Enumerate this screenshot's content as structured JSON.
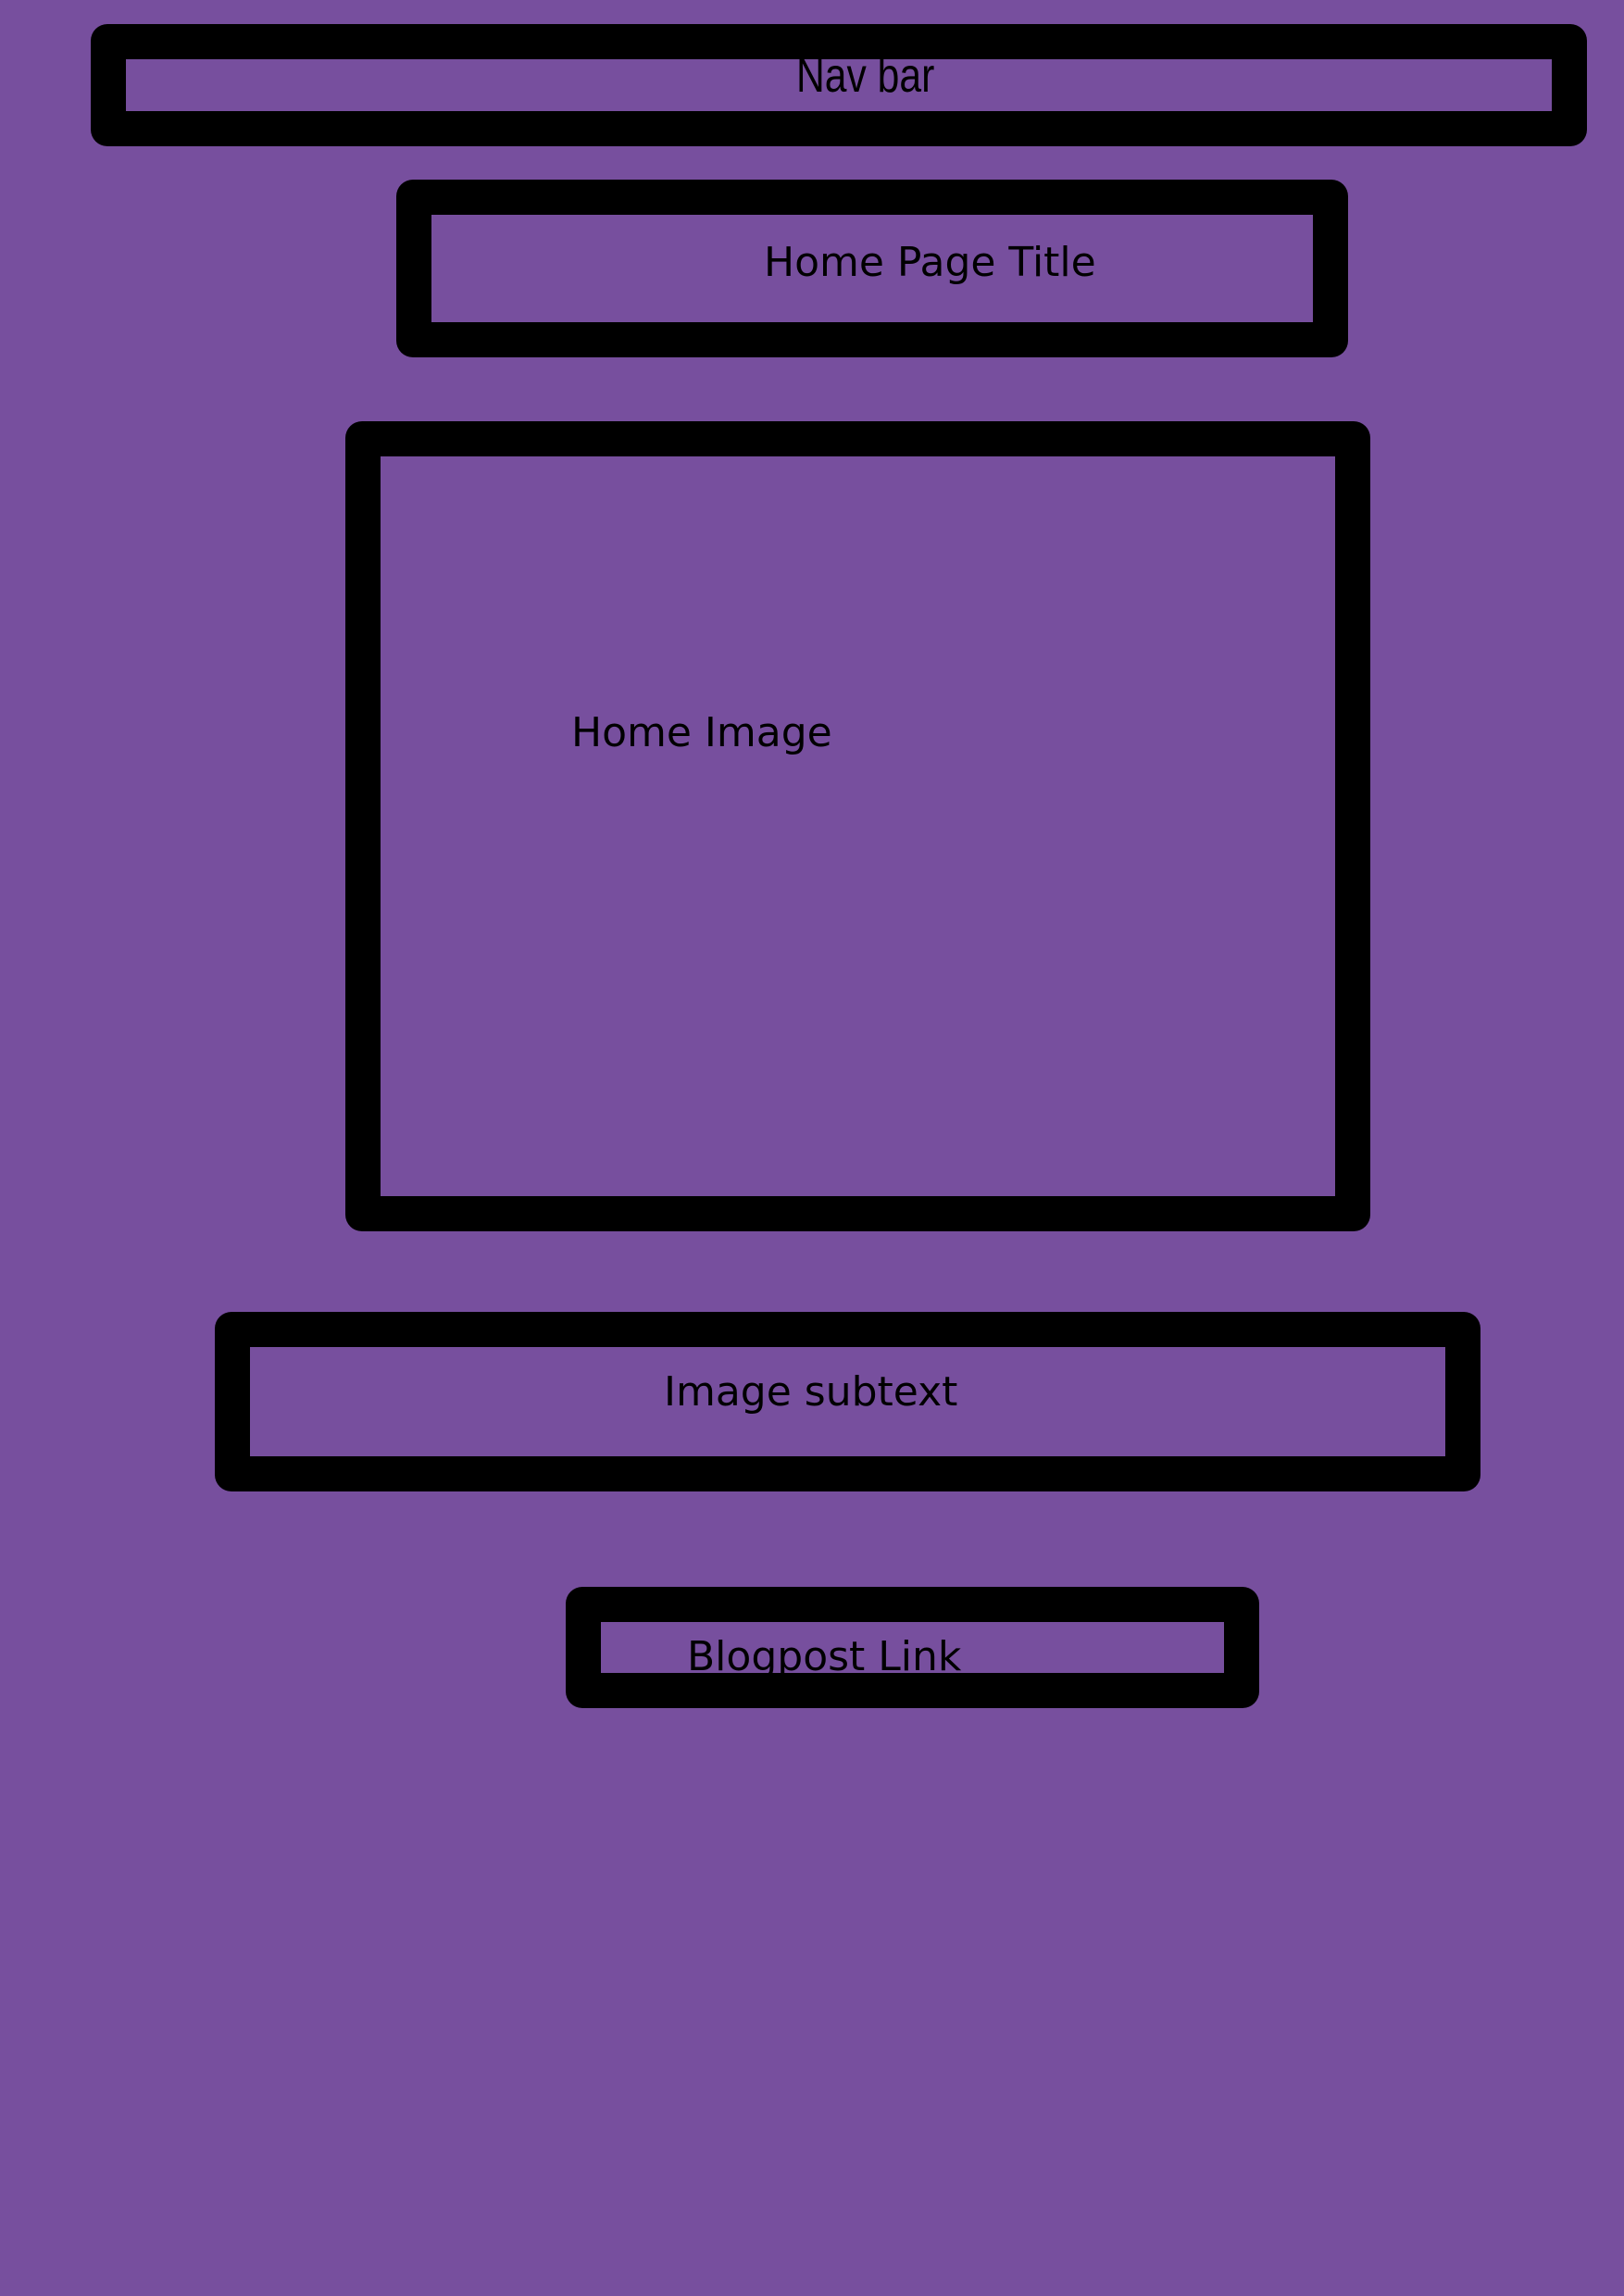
{
  "colors": {
    "background": "#774f9e",
    "outline": "#000000"
  },
  "nav": {
    "label": "Nav bar"
  },
  "title": {
    "label": "Home Page Title"
  },
  "image": {
    "label": "Home Image"
  },
  "subtext": {
    "label": "Image subtext"
  },
  "blog": {
    "label": "Blogpost Link"
  }
}
